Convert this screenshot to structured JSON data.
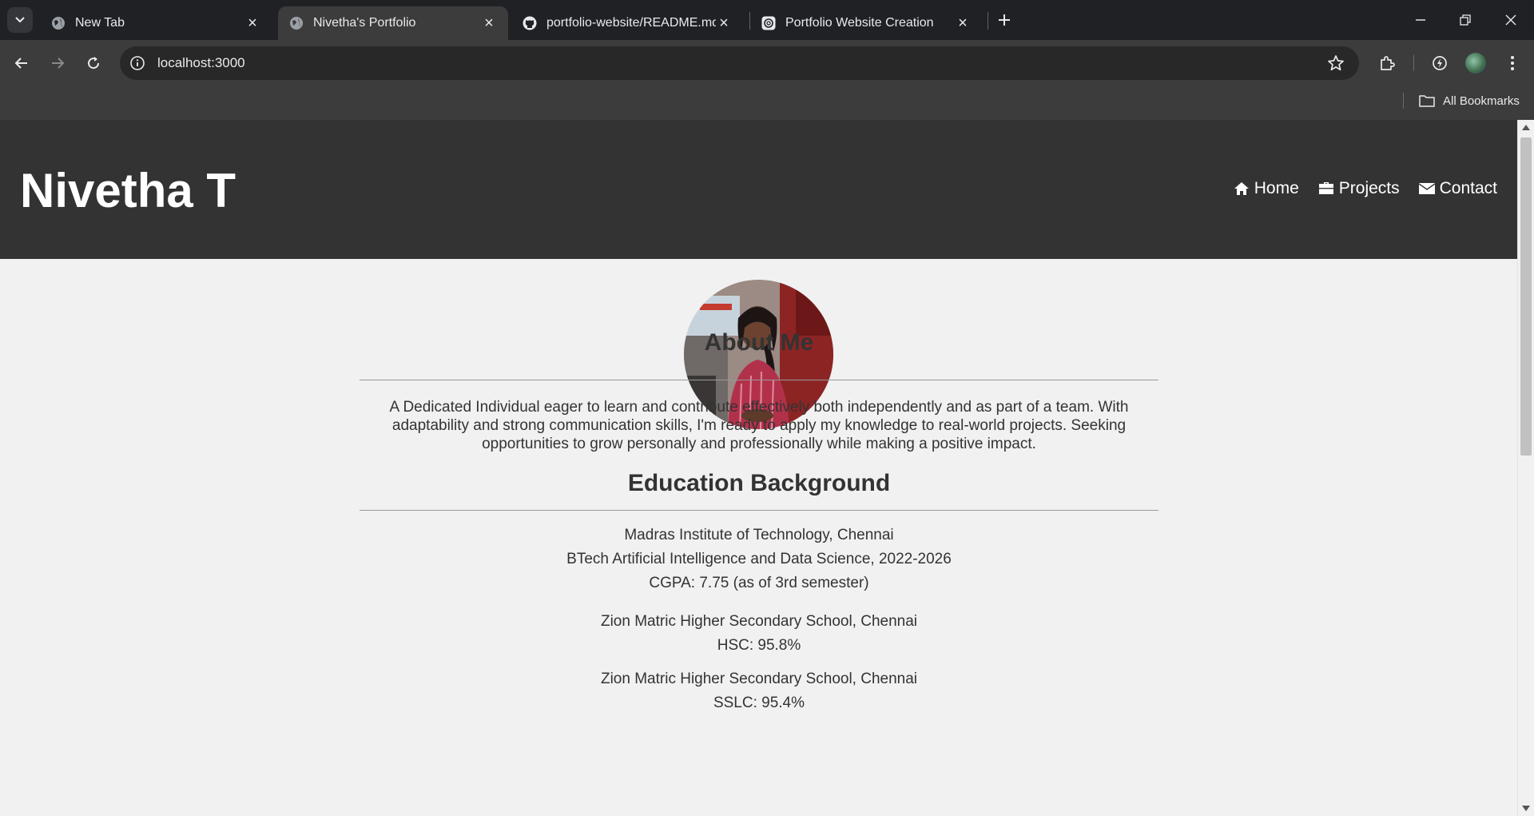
{
  "browser": {
    "tabs": [
      {
        "title": "New Tab",
        "icon": "globe-icon"
      },
      {
        "title": "Nivetha's Portfolio",
        "icon": "globe-icon",
        "active": true
      },
      {
        "title": "portfolio-website/README.md",
        "icon": "github-icon"
      },
      {
        "title": "Portfolio Website Creation",
        "icon": "chatgpt-icon"
      }
    ],
    "url": "localhost:3000",
    "bookmarks_label": "All Bookmarks"
  },
  "site": {
    "name": "Nivetha T",
    "nav": [
      {
        "label": "Home",
        "icon": "home-icon"
      },
      {
        "label": "Projects",
        "icon": "briefcase-icon"
      },
      {
        "label": "Contact",
        "icon": "envelope-icon"
      }
    ]
  },
  "about": {
    "heading": "About Me",
    "lines": [
      "A Dedicated Individual eager to learn and contribute effectively both independently and as part of a team. With",
      "adaptability and strong communication skills, I'm ready to apply my knowledge to real-world projects. Seeking",
      "opportunities to grow personally and professionally while making a positive impact."
    ]
  },
  "education": {
    "heading": "Education Background",
    "entries": [
      {
        "lines": [
          "Madras Institute of Technology, Chennai",
          "BTech Artificial Intelligence and Data Science, 2022-2026",
          "CGPA: 7.75 (as of 3rd semester)"
        ]
      },
      {
        "lines": [
          "Zion Matric Higher Secondary School, Chennai",
          "HSC: 95.8%"
        ]
      },
      {
        "lines": [
          "Zion Matric Higher Secondary School, Chennai",
          "SSLC: 95.4%"
        ]
      }
    ]
  },
  "colors": {
    "header_bg": "#333333",
    "page_bg": "#f1f1f1",
    "text": "#333333"
  }
}
